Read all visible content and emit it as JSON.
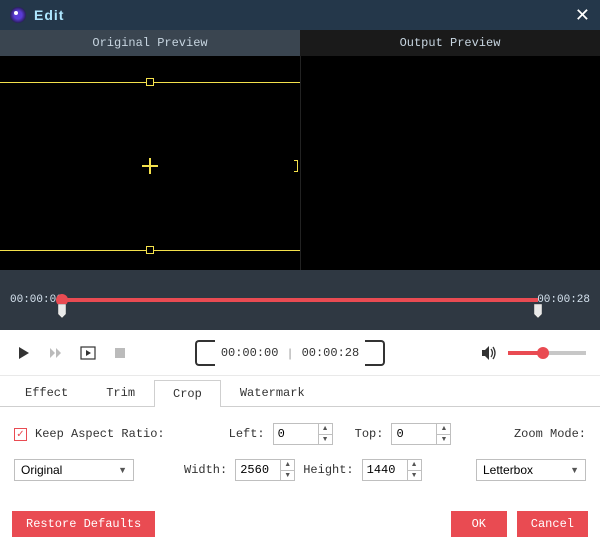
{
  "titlebar": {
    "title": "Edit"
  },
  "preview": {
    "left_label": "Original Preview",
    "right_label": "Output Preview"
  },
  "timeline": {
    "start": "00:00:00",
    "end": "00:00:28"
  },
  "playback": {
    "current": "00:00:00",
    "total": "00:00:28"
  },
  "tabs": {
    "effect": "Effect",
    "trim": "Trim",
    "crop": "Crop",
    "watermark": "Watermark"
  },
  "crop": {
    "keep_ratio_label": "Keep Aspect Ratio:",
    "left_label": "Left:",
    "left": "0",
    "top_label": "Top:",
    "top": "0",
    "width_label": "Width:",
    "width": "2560",
    "height_label": "Height:",
    "height": "1440",
    "zoom_mode_label": "Zoom Mode:",
    "aspect_selected": "Original",
    "zoom_selected": "Letterbox"
  },
  "buttons": {
    "restore": "Restore Defaults",
    "ok": "OK",
    "cancel": "Cancel"
  }
}
